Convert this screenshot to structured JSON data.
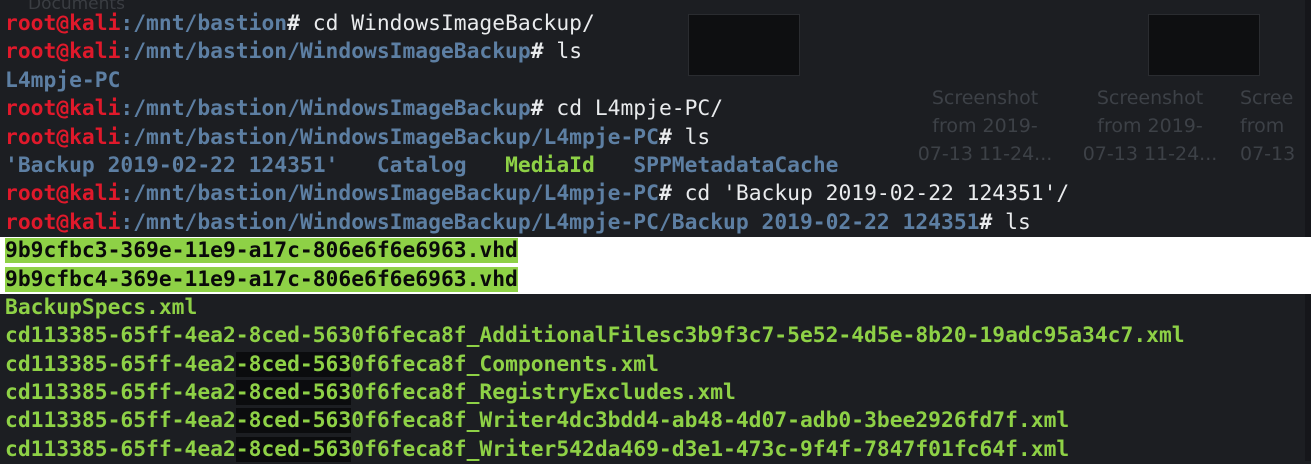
{
  "background": {
    "caption": "Documents",
    "thumbnails": [
      {
        "line1": "Screenshot",
        "line2": "from 2019-",
        "line3": "07-13 11-24..."
      },
      {
        "line1": "Screenshot",
        "line2": "from 2019-",
        "line3": "07-13 11-24..."
      },
      {
        "line1": "Scree",
        "line2": "from",
        "line3": "07-13"
      }
    ]
  },
  "terminal": {
    "user_host": "root@kali",
    "colors": {
      "user": "#e0192b",
      "path": "#5d7fa3",
      "exec_file": "#8ed146",
      "highlight_bg": "#8ed146",
      "selection_bg": "#ffffff"
    },
    "prompts": [
      {
        "path": ":/mnt/bastion",
        "symbol": "#",
        "command": " cd WindowsImageBackup/"
      },
      {
        "path": ":/mnt/bastion/WindowsImageBackup",
        "symbol": "#",
        "command": " ls"
      },
      {
        "path": ":/mnt/bastion/WindowsImageBackup",
        "symbol": "#",
        "command": " cd L4mpje-PC/"
      },
      {
        "path": ":/mnt/bastion/WindowsImageBackup/L4mpje-PC",
        "symbol": "#",
        "command": " ls"
      },
      {
        "path": ":/mnt/bastion/WindowsImageBackup/L4mpje-PC",
        "symbol": "#",
        "command": " cd 'Backup 2019-02-22 124351'/"
      },
      {
        "path": ":/mnt/bastion/WindowsImageBackup/L4mpje-PC/Backup 2019-02-22 124351",
        "symbol": "#",
        "command": " ls"
      }
    ],
    "ls_output_1": [
      "L4mpje-PC"
    ],
    "ls_output_2": {
      "backup_dir": "'Backup 2019-02-22 124351'",
      "catalog": "Catalog",
      "mediaid": "MediaId",
      "spp": "SPPMetadataCache"
    },
    "ls_output_3": {
      "vhd1": "9b9cfbc3-369e-11e9-a17c-806e6f6e6963.vhd",
      "vhd2": "9b9cfbc4-369e-11e9-a17c-806e6f6e6963.vhd",
      "backupspecs": "BackupSpecs.xml",
      "additional": "cd113385-65ff-4ea2-8ced-5630f6feca8f_AdditionalFilesc3b9f3c7-5e52-4d5e-8b20-19adc95a34c7.xml",
      "components_a": "cd113385-65ff-4ea2",
      "components_b": "-8ced-563",
      "components_c": "0f6feca8f_Components.xml",
      "registry_a": "cd113385-65ff-4ea2",
      "registry_b": "-8ced-563",
      "registry_c": "0f6feca8f_RegistryExcludes.xml",
      "writer1_a": "cd113385-65ff-4ea2",
      "writer1_b": "-8ced-563",
      "writer1_c": "0f6feca8f_Writer4dc3bdd4-ab48-4d07-adb0-3bee2926fd7f.xml",
      "writer2_a": "cd113385-65ff-4ea2",
      "writer2_b": "-8ced-563",
      "writer2_c": "0f6feca8f_Writer542da469-d3e1-473c-9f4f-7847f01fc64f.xml"
    }
  }
}
